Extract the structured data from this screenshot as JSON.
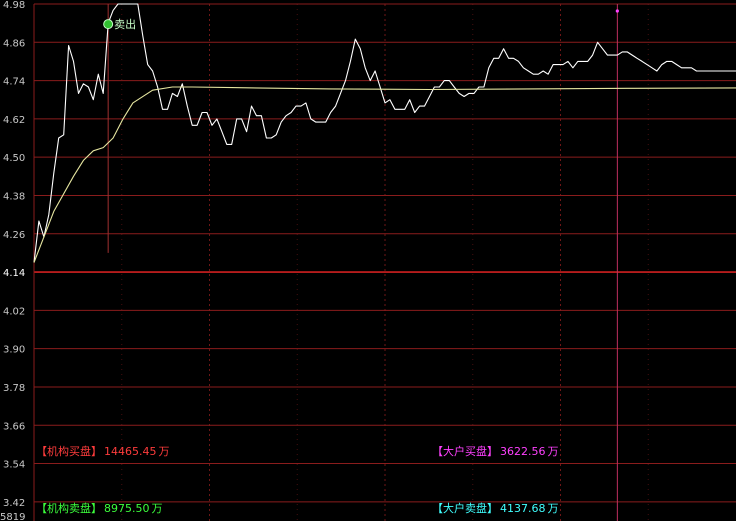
{
  "chart_data": {
    "type": "line",
    "title": "",
    "xlabel": "",
    "ylabel": "",
    "ylim": [
      3.36,
      4.98
    ],
    "base_price": 4.14,
    "y_ticks": [
      "4.98",
      "4.86",
      "4.74",
      "4.62",
      "4.50",
      "4.38",
      "4.26",
      "4.14",
      "4.02",
      "3.90",
      "3.78",
      "3.66",
      "3.54",
      "3.42"
    ],
    "grid": true,
    "bottom_partial_label": "5819",
    "series": [
      {
        "color": "#ffffff",
        "x": [
          0,
          1,
          2,
          3,
          4,
          5,
          6,
          7,
          8,
          9,
          10,
          11,
          12,
          13,
          14,
          15,
          16,
          17,
          18,
          19,
          20,
          21,
          22,
          23,
          24,
          25,
          26,
          27,
          28,
          29,
          30,
          31,
          32,
          33,
          34,
          35,
          36,
          37,
          38,
          39,
          40,
          41,
          42,
          43,
          44,
          45,
          46,
          47,
          48,
          49,
          50,
          51,
          52,
          53,
          54,
          55,
          56,
          57,
          58,
          59,
          60,
          61,
          62,
          63,
          64,
          65,
          66,
          67,
          68,
          69,
          70,
          71,
          72,
          73,
          74,
          75,
          76,
          77,
          78,
          79,
          80,
          81,
          82,
          83,
          84,
          85,
          86,
          87,
          88,
          89,
          90,
          91,
          92,
          93,
          94,
          95,
          96,
          97,
          98,
          99,
          100,
          101,
          102,
          103,
          104,
          105,
          106,
          107,
          108,
          109,
          110,
          111,
          112,
          113,
          114,
          115,
          116,
          117,
          118,
          119,
          120,
          121,
          122,
          123,
          124,
          125,
          126,
          127,
          128,
          129,
          130,
          131,
          132,
          133,
          134,
          135,
          136,
          137,
          138,
          139,
          140,
          141,
          142
        ],
        "values": [
          4.17,
          4.3,
          4.25,
          4.32,
          4.45,
          4.56,
          4.57,
          4.85,
          4.8,
          4.7,
          4.73,
          4.72,
          4.68,
          4.76,
          4.7,
          4.92,
          4.96,
          4.98,
          4.98,
          4.98,
          4.98,
          4.98,
          4.88,
          4.79,
          4.77,
          4.72,
          4.65,
          4.65,
          4.7,
          4.69,
          4.73,
          4.66,
          4.6,
          4.6,
          4.64,
          4.64,
          4.6,
          4.62,
          4.58,
          4.54,
          4.54,
          4.62,
          4.62,
          4.58,
          4.66,
          4.63,
          4.63,
          4.56,
          4.56,
          4.57,
          4.61,
          4.63,
          4.64,
          4.66,
          4.66,
          4.67,
          4.62,
          4.61,
          4.61,
          4.61,
          4.64,
          4.66,
          4.7,
          4.74,
          4.8,
          4.87,
          4.84,
          4.78,
          4.74,
          4.77,
          4.72,
          4.67,
          4.68,
          4.65,
          4.65,
          4.65,
          4.68,
          4.64,
          4.66,
          4.66,
          4.69,
          4.72,
          4.72,
          4.74,
          4.74,
          4.72,
          4.7,
          4.69,
          4.7,
          4.7,
          4.72,
          4.72,
          4.78,
          4.81,
          4.81,
          4.84,
          4.81,
          4.81,
          4.8,
          4.78,
          4.77,
          4.76,
          4.76,
          4.77,
          4.76,
          4.79,
          4.79,
          4.79,
          4.8,
          4.78,
          4.8,
          4.8,
          4.8,
          4.82,
          4.86,
          4.84,
          4.82,
          4.82,
          4.82,
          4.83,
          4.83,
          4.82,
          4.81,
          4.8,
          4.79,
          4.78,
          4.77,
          4.79,
          4.8,
          4.8,
          4.79,
          4.78,
          4.78,
          4.78,
          4.77,
          4.77,
          4.77,
          4.77,
          4.77,
          4.77,
          4.77,
          4.77,
          4.77
        ]
      },
      {
        "color": "#e6e6a0",
        "x": [
          0,
          4,
          8,
          10,
          12,
          14,
          16,
          18,
          20,
          24,
          28,
          32,
          40,
          60,
          80,
          100,
          120,
          142
        ],
        "values": [
          4.17,
          4.33,
          4.44,
          4.49,
          4.52,
          4.53,
          4.56,
          4.62,
          4.67,
          4.71,
          4.72,
          4.72,
          4.718,
          4.714,
          4.712,
          4.714,
          4.716,
          4.717
        ]
      }
    ],
    "x_count": 142,
    "markers": [
      {
        "x": 15,
        "y_from": 4.98,
        "y_to": 4.2,
        "color": "#a03030"
      },
      {
        "x": 118,
        "y_from": 4.98,
        "y_to": 3.36,
        "color": "#c03060"
      }
    ],
    "signal": {
      "x": 15,
      "y": 4.92,
      "icon": "sell-signal-icon",
      "label": "卖出",
      "color": "#30c030"
    },
    "top_marker_x": 118
  },
  "legend": {
    "inst_buy": {
      "open": "【",
      "name": "机构买盘",
      "close": "】",
      "value": "14465.45",
      "unit": "万",
      "color": "#ff3c3c"
    },
    "inst_sell": {
      "open": "【",
      "name": "机构卖盘",
      "close": "】",
      "value": "8975.50",
      "unit": "万",
      "color": "#3cff3c"
    },
    "big_buy": {
      "open": "【",
      "name": "大户买盘",
      "close": "】",
      "value": "3622.56",
      "unit": "万",
      "color": "#ff40ff"
    },
    "big_sell": {
      "open": "【",
      "name": "大户卖盘",
      "close": "】",
      "value": "4137.68",
      "unit": "万",
      "color": "#40ffff"
    }
  },
  "colors": {
    "grid": "#8a1c1c",
    "base_line": "#d02020",
    "axis_text": "#c8c8c8",
    "background": "#000000"
  }
}
